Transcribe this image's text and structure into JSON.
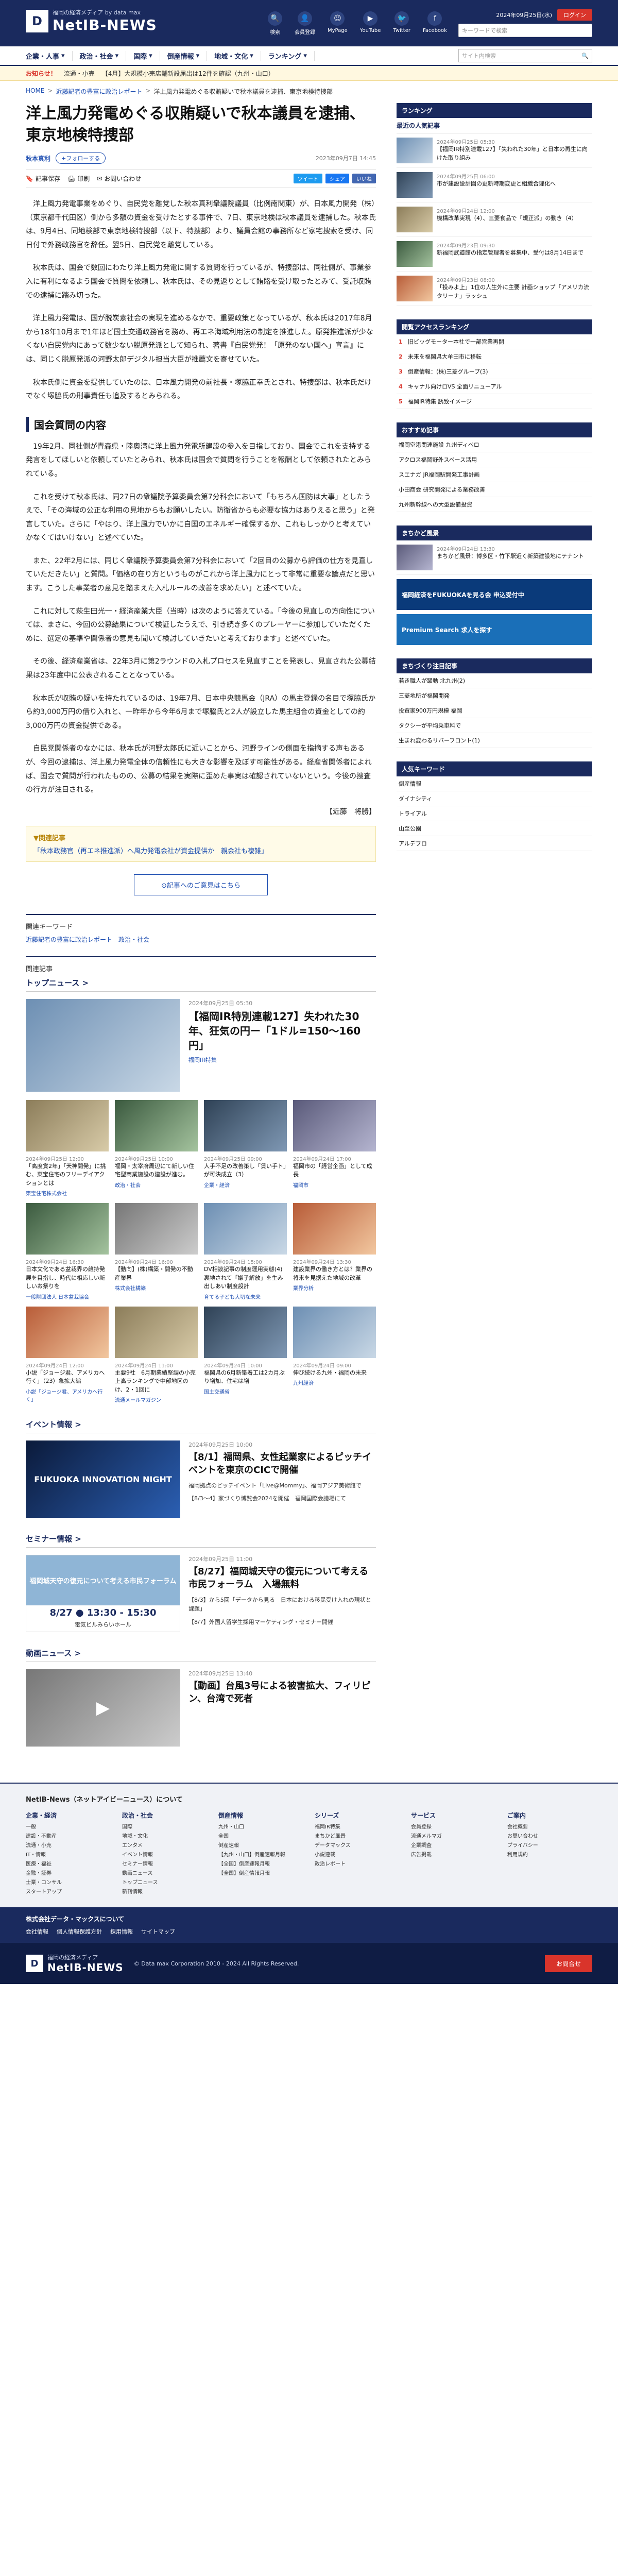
{
  "header": {
    "tagline": "福岡の経済メディア",
    "by": "by data max",
    "logo_mark": "D",
    "site_name": "NetIB-NEWS",
    "icons": [
      {
        "label": "検索",
        "icon": "search-icon",
        "glyph": "🔍"
      },
      {
        "label": "会員登録",
        "icon": "user-add-icon",
        "glyph": "👤"
      },
      {
        "label": "MyPage",
        "icon": "mypage-icon",
        "glyph": "☺"
      },
      {
        "label": "YouTube",
        "icon": "youtube-icon",
        "glyph": "▶"
      },
      {
        "label": "Twitter",
        "icon": "twitter-icon",
        "glyph": "🐦"
      },
      {
        "label": "Facebook",
        "icon": "facebook-icon",
        "glyph": "f"
      }
    ],
    "date": "2024年09月25日(水)",
    "login": "ログイン",
    "search_placeholder": "キーワードで検索"
  },
  "gnav": [
    "企業・人事",
    "政治・社会",
    "国際",
    "倒産情報",
    "地域・文化",
    "ランキング"
  ],
  "gnav_search": "サイト内検索",
  "ticker": {
    "label": "お知らせ！",
    "items": [
      "流通・小売",
      "【4月】大規模小売店舗新設届出は12件を確認（九州・山口）"
    ]
  },
  "breadcrumb": [
    "HOME",
    "近藤記者の豊富に政治レポート",
    "洋上風力発電めぐる収賄疑いで秋本議員を逮捕、東京地検特捜部"
  ],
  "article": {
    "title": "洋上風力発電めぐる収賄疑いで秋本議員を逮捕、東京地検特捜部",
    "author": "秋本真利",
    "follow": "+フォローする",
    "date": "2023年09月7日 14:45",
    "tools": [
      "記事保存",
      "印刷",
      "お問い合わせ"
    ],
    "share": [
      "ツイート",
      "シェア",
      "いいね"
    ],
    "paras1": [
      "洋上風力発電事業をめぐり、自民党を離党した秋本真利衆議院議員（比例南関東）が、日本風力開発（株）（東京都千代田区）側から多額の資金を受けたとする事件で、7日、東京地検は秋本議員を逮捕した。秋本氏は、9月4日、同地検部で東京地検特捜部（以下、特捜部）より、議員会館の事務所など家宅捜索を受け、同日付で外務政務官を辞任。翌5日、自民党を離党している。",
      "秋本氏は、国会で数回にわたり洋上風力発電に関する質問を行っているが、特捜部は、同社側が、事業参入に有利になるよう国会で質問を依頼し、秋本氏は、その見返りとして賄賂を受け取ったとみて、受託収賄での逮捕に踏み切った。",
      "洋上風力発電は、国が脱炭素社会の実現を進めるなかで、重要政策となっているが、秋本氏は2017年8月から18年10月まで1年ほど国土交通政務官を務め、再エネ海域利用法の制定を推進した。原発推進派が少なくない自民党内にあって数少ない脱原発派として知られ、著書『自民党発！「原発のない国へ」宣言』には、同じく脱原発派の河野太郎デジタル担当大臣が推薦文を寄せていた。",
      "秋本氏側に資金を提供していたのは、日本風力開発の前社長・塚脇正幸氏とされ、特捜部は、秋本氏だけでなく塚脇氏の刑事責任も追及するとみられる。"
    ],
    "h2": "国会質問の内容",
    "paras2": [
      "19年2月、同社側が青森県・陸奥湾に洋上風力発電所建設の参入を目指しており、国会でこれを支持する発言をしてほしいと依頼していたとみられ、秋本氏は国会で質問を行うことを報酬として依頼されたとみられている。",
      "これを受けて秋本氏は、同27日の衆議院予算委員会第7分科会において「もちろん国防は大事」としたうえで、「その海域の公正な利用の見地からもお願いしたい。防衛省からも必要な協力はありえると思う」と発言していた。さらに「やはり、洋上風力でいかに自国のエネルギー確保するか、これもしっかりと考えていかなくてはいけない」と述べていた。",
      "また、22年2月には、同じく衆議院予算委員会第7分科会において「2回目の公募から評価の仕方を見直していただきたい」と質問。「価格の在り方というものがこれから洋上風力にとって非常に重要な論点だと思います。こうした事業者の意見を踏まえた入札ルールの改善を求めたい」と述べていた。",
      "これに対して萩生田光一・経済産業大臣（当時）は次のように答えている。「今後の見直しの方向性については、まさに、今回の公募結果について検証したうえで、引き続き多くのプレーヤーに参加していただくために、選定の基準や関係者の意見も聞いて検討していきたいと考えております」と述べていた。",
      "その後、経済産業省は、22年3月に第2ラウンドの入札プロセスを見直すことを発表し、見直された公募結果は23年度中に公表されることとなっている。",
      "秋本氏が収賄の疑いを持たれているのは、19年7月、日本中央競馬会（JRA）の馬主登録の名目で塚脇氏から約3,000万円の借り入れと、一昨年から今年6月まで塚脇氏と2人が設立した馬主組合の資金としての約3,000万円の資金提供である。",
      "自民党関係者のなかには、秋本氏が河野太郎氏に近いことから、河野ラインの側面を指摘する声もあるが、今回の逮捕は、洋上風力発電全体の信頼性にも大きな影響を及ぼす可能性がある。経産省関係者によれば、国会で質問が行われたものの、公募の結果を実際に歪めた事実は確認されていないという。今後の捜査の行方が注目される。"
    ],
    "tail": "【近藤　将勝】",
    "related_title": "▼関連記事",
    "related_link": "「秋本政務官（再エネ推進派）へ風力発電会社が資金提供か　親会社も複雑」",
    "more": "⊙記事へのご意見はこちら"
  },
  "keywords": {
    "label": "関連キーワード",
    "items": [
      "近藤記者の豊富に政治レポート",
      "政治・社会"
    ]
  },
  "related_label": "関連記事",
  "topnews": {
    "head": "トップニュース >",
    "feature": {
      "date": "2024年09月25日 05:30",
      "title": "【福岡IR特別連載127】失われた30年、狂気の円ー「1ドル=150〜160円」",
      "tag": "福岡IR特集"
    },
    "cards": [
      {
        "date": "2024年09月25日 12:00",
        "title": "「高度賞2年」「天神開発」に挑む、東宝住宅のフリーデイアクションとは",
        "tag": "東宝住宅株式会社"
      },
      {
        "date": "2024年09月25日 10:00",
        "title": "福岡・太宰府周辺にて新しい住宅型商業施設の建設が進む。",
        "tag": "政治・社会"
      },
      {
        "date": "2024年09月25日 09:00",
        "title": "人手不足の改善策し「賃い手ト」が可決成立（3）",
        "tag": "企業・経済"
      },
      {
        "date": "2024年09月24日 17:00",
        "title": "福岡市の「経営企画」として成長",
        "tag": "福岡市"
      },
      {
        "date": "2024年09月24日 16:30",
        "title": "日本文化である盆栽界の維持発展を目指し、時代に相応しい新しいお祭りを",
        "tag": "一般財団法人 日本盆栽協会"
      },
      {
        "date": "2024年09月24日 16:00",
        "title": "【動向】(株)構築・開発の不動産業界",
        "tag": "株式会社構築"
      },
      {
        "date": "2024年09月24日 15:00",
        "title": "DV相談記事の制度運用実態(4) 裏地されて「嫌子解放」を生み出しあい制度設計",
        "tag": "育てる子ども大切な未来"
      },
      {
        "date": "2024年09月24日 13:30",
        "title": "建設業界の働き方とは？業界の将来を見据えた地域の改革",
        "tag": "業界分析"
      },
      {
        "date": "2024年09月24日 12:00",
        "title": "小説「ジョージ君、アメリカへ行く」（23）急拡大編",
        "tag": "小説「ジョージ君、アメリカへ行く」"
      },
      {
        "date": "2024年09月24日 11:00",
        "title": "主要9社　6月期業績堅調の小売上高ランキングで中部地区のけ、2・1回に",
        "tag": "流通メールマガジン"
      },
      {
        "date": "2024年09月24日 10:00",
        "title": "福岡県の6月新築着工は2カ月ぶり増加、住宅は増",
        "tag": "国土交通省"
      },
      {
        "date": "2024年09月24日 09:00",
        "title": "伸び続ける九州・福岡の未来",
        "tag": "九州経済"
      }
    ]
  },
  "events": {
    "head": "イベント情報 >",
    "items": [
      {
        "date": "2024年09月25日 10:00",
        "title": "【8/1】福岡県、女性起業家によるピッチイベントを東京のCICで開催",
        "sub": "福岡拠点のピッチイベント「Live@Mommy」、福岡アジア美術館で",
        "sub2": "【8/3〜4】家づくり博覧会2024を開催　福岡国際会議場にて",
        "banner": "FUKUOKA INNOVATION NIGHT"
      }
    ]
  },
  "seminar": {
    "head": "セミナー情報 >",
    "items": [
      {
        "date": "2024年09月25日 11:00",
        "title": "【8/27】福岡城天守の復元について考える市民フォーラム　入場無料",
        "sub": "【8/3】から5回「データから見る　日本における移民受け入れの現状と課題」",
        "sub2": "【8/7】外国人留学生採用マーケティング・セミナー開催",
        "banner_top": "福岡城天守の復元について考える市民フォーラム",
        "banner_date": "8/27 ● 13:30 - 15:30",
        "banner_venue": "電気ビルみらいホール"
      }
    ]
  },
  "video": {
    "head": "動画ニュース >",
    "date": "2024年09月25日 13:40",
    "title": "【動画】台風3号による被害拡大、フィリピン、台湾で死者"
  },
  "sidebar": {
    "ranking_head": "ランキング",
    "latest_head": "最近の人気記事",
    "latest": [
      {
        "date": "2024年09月25日 05:30",
        "title": "【福岡IR特別連載127】「失われた30年」と日本の再生に向けた取り組み"
      },
      {
        "date": "2024年09月25日 06:00",
        "title": "市が建設設計図の更新時期変更と組織合理化へ"
      },
      {
        "date": "2024年09月24日 12:00",
        "title": "機構改革実現（4）、三菱食品で「規正派」の動き（4）"
      },
      {
        "date": "2024年09月23日 09:30",
        "title": "新福岡武道館の指定管理者を募集中、受付は8月14日まで"
      },
      {
        "date": "2024年09月23日 08:00",
        "title": "「投みよ上」1位の人生外に主要 計画ショップ「アメリカ流タリーナ」ラッシュ"
      }
    ],
    "access_head": "閲覧アクセスランキング",
    "access": [
      "旧ビッグモーター本社で一部営業再開",
      "未来を福岡県大牟田市に移転",
      "倒産情報：(株)三菱グループ(3)",
      "キャナル向けロVS 全面リニューアル",
      "福岡IR特集 誘致イメージ"
    ],
    "recommend_head": "おすすめ記事",
    "recommend": [
      "福岡空港関連施設 九州ディベロ",
      "アクロス福岡野外スペース活用",
      "スエナガ JR福岡駅開発工事計画",
      "小田商会 研究開発による業務改善",
      "九州新幹線への大型設備投資"
    ],
    "local_head": "まちかど風景",
    "local": {
      "date": "2024年09月24日 13:30",
      "title": "まちかど風景：博多区・竹下駅近く新築建設地にテナント"
    },
    "banner1": "福岡経済をFUKUOKAを見る会 申込受付中",
    "banner2": "Premium Search 求人を探す",
    "pickup_head": "まちづくり注目記事",
    "pickup": [
      "若き職人が躍動 北九州(2)",
      "三菱地所が福岡開発",
      "投資家900万円規模 福岡",
      "タクシーが平均乗車料で",
      "生まれ変わるリバーフロント(1)"
    ],
    "people_head": "人気キーワード",
    "people": [
      "倒産情報",
      "ダイナシティ",
      "トライアル",
      "山至公園",
      "アルデプロ"
    ]
  },
  "footer": {
    "title": "NetIB-News（ネットアイビーニュース）について",
    "cols": [
      {
        "head": "企業・経済",
        "items": [
          "一般",
          "建設・不動産",
          "流通・小売",
          "IT・情報",
          "医療・福祉",
          "金融・証券",
          "士業・コンサル",
          "スタートアップ"
        ]
      },
      {
        "head": "政治・社会",
        "items": [
          "国際",
          "地域・文化",
          "エンタメ",
          "イベント情報",
          "セミナー情報",
          "動画ニュース",
          "トップニュース",
          "新刊情報"
        ]
      },
      {
        "head": "倒産情報",
        "items": [
          "九州・山口",
          "全国",
          "倒産速報",
          "【九州・山口】倒産速報月報",
          "【全国】倒産速報月報",
          "【全国】倒産情報月報"
        ]
      },
      {
        "head": "シリーズ",
        "items": [
          "福岡IR特集",
          "まちかど風景",
          "データマックス",
          "小説連載",
          "政治レポート"
        ]
      },
      {
        "head": "サービス",
        "items": [
          "会員登録",
          "流通メルマガ",
          "企業調査",
          "広告掲載"
        ]
      },
      {
        "head": "ご案内",
        "items": [
          "会社概要",
          "お問い合わせ",
          "プライバシー",
          "利用規約"
        ]
      }
    ],
    "bar_title": "株式会社データ・マックスについて",
    "bar_links": [
      "会社情報",
      "個人情報保護方針",
      "採用情報",
      "サイトマップ"
    ],
    "copy": "© Data max Corporation 2010 - 2024 All Rights Reserved.",
    "pay": "お問合せ"
  },
  "colors": {
    "brand": "#1a2a5e",
    "accent": "#d9342b",
    "link": "#1a4bb0"
  }
}
